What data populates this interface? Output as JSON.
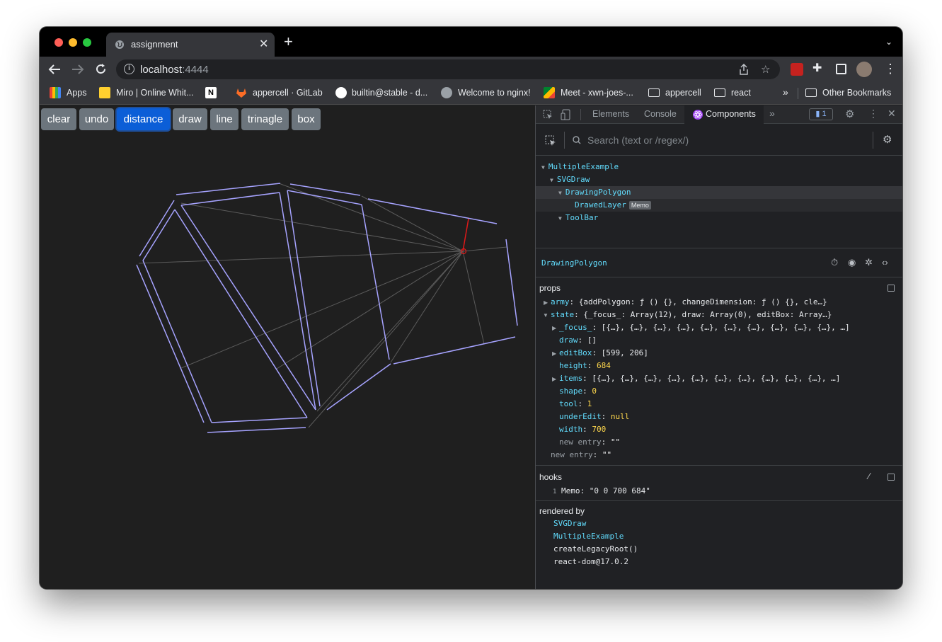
{
  "browser": {
    "tab_title": "assignment",
    "url_host": "localhost",
    "url_port": ":4444"
  },
  "bookmarks": [
    {
      "label": "Apps",
      "icon": "apps-grid-icon"
    },
    {
      "label": "Miro | Online Whit...",
      "icon": "miro-icon"
    },
    {
      "label": "",
      "icon": "notion-icon"
    },
    {
      "label": "appercell · GitLab",
      "icon": "gitlab-icon"
    },
    {
      "label": "builtin@stable - d...",
      "icon": "cluster-icon"
    },
    {
      "label": "Welcome to nginx!",
      "icon": "globe-icon"
    },
    {
      "label": "Meet - xwn-joes-...",
      "icon": "meet-icon"
    },
    {
      "label": "appercell",
      "icon": "folder-icon"
    },
    {
      "label": "react",
      "icon": "folder-icon"
    },
    {
      "label": "»",
      "icon": ""
    },
    {
      "label": "Other Bookmarks",
      "icon": "folder-icon"
    }
  ],
  "app": {
    "buttons": [
      "clear",
      "undo",
      "distance",
      "draw",
      "line",
      "trinagle",
      "box"
    ],
    "active_button": "distance"
  },
  "devtools": {
    "tabs": [
      "Elements",
      "Console",
      "Components"
    ],
    "active_tab": "Components",
    "issues_count": "1",
    "search_placeholder": "Search (text or /regex/)",
    "tree": [
      {
        "label": "MultipleExample",
        "depth": 0
      },
      {
        "label": "SVGDraw",
        "depth": 1
      },
      {
        "label": "DrawingPolygon",
        "depth": 2
      },
      {
        "label": "DrawedLayer",
        "depth": 3,
        "badge": "Memo"
      },
      {
        "label": "ToolBar",
        "depth": 2
      }
    ],
    "selected_component": "DrawingPolygon",
    "props_title": "props",
    "props": {
      "army_key": "army",
      "army_val": "{addPolygon: ƒ () {}, changeDimension: ƒ () {}, cle…}",
      "state_key": "state",
      "state_val": "{_focus_: Array(12), draw: Array(0), editBox: Array…}",
      "focus_key": "_focus_",
      "focus_val": "[{…}, {…}, {…}, {…}, {…}, {…}, {…}, {…}, {…}, {…}, …]",
      "draw_key": "draw",
      "draw_val": "[]",
      "editbox_key": "editBox",
      "editbox_val": "[599, 206]",
      "height_key": "height",
      "height_val": "684",
      "items_key": "items",
      "items_val": "[{…}, {…}, {…}, {…}, {…}, {…}, {…}, {…}, {…}, {…}, …]",
      "shape_key": "shape",
      "shape_val": "0",
      "tool_key": "tool",
      "tool_val": "1",
      "underedit_key": "underEdit",
      "underedit_val": "null",
      "width_key": "width",
      "width_val": "700",
      "new_entry_key": "new entry",
      "new_entry_val": "\"\""
    },
    "hooks_title": "hooks",
    "hook_index": "1",
    "hook_line": "Memo: \"0 0 700 684\"",
    "rendered_by_title": "rendered by",
    "rendered_by": [
      "SVGDraw",
      "MultipleExample",
      "createLegacyRoot()",
      "react-dom@17.0.2"
    ]
  },
  "colors": {
    "polygon_stroke": "#a6a3ff",
    "guide_stroke": "#5b5b5b",
    "marker": "#e01919",
    "active_button": "#0b5ed7",
    "button": "#6c757d"
  }
}
